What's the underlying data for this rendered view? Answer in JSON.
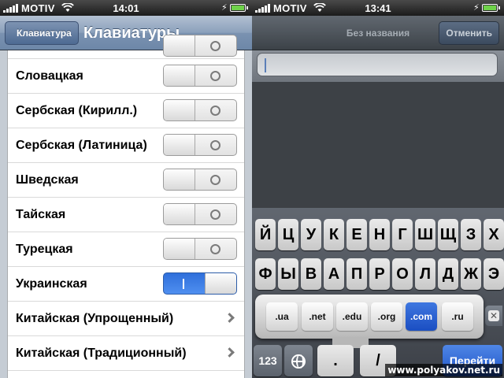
{
  "left": {
    "status": {
      "carrier": "MOTIV",
      "time": "14:01"
    },
    "nav": {
      "back_label": "Клавиатура",
      "title": "Клавиатуры"
    },
    "rows": [
      {
        "label": "Словацкая",
        "state": "off"
      },
      {
        "label": "Сербская (Кирилл.)",
        "state": "off"
      },
      {
        "label": "Сербская (Латиница)",
        "state": "off"
      },
      {
        "label": "Шведская",
        "state": "off"
      },
      {
        "label": "Тайская",
        "state": "off"
      },
      {
        "label": "Турецкая",
        "state": "off"
      },
      {
        "label": "Украинская",
        "state": "on"
      },
      {
        "label": "Китайская (Упрощенный)",
        "state": "chevron"
      },
      {
        "label": "Китайская (Традиционный)",
        "state": "chevron"
      }
    ]
  },
  "right": {
    "status": {
      "carrier": "MOTIV",
      "time": "13:41"
    },
    "nav": {
      "title": "Без названия",
      "cancel_label": "Отменить"
    },
    "keyboard": {
      "row1": [
        "Й",
        "Ц",
        "У",
        "К",
        "Е",
        "Н",
        "Г",
        "Ш",
        "Щ",
        "З",
        "Х"
      ],
      "row2": [
        "Ф",
        "Ы",
        "В",
        "А",
        "П",
        "Р",
        "О",
        "Л",
        "Д",
        "Ж",
        "Э"
      ],
      "domains": [
        ".ua",
        ".net",
        ".edu",
        ".org",
        ".com",
        ".ru"
      ],
      "active_domain": ".com",
      "num_key": "123",
      "dot_key": ".",
      "slash_key": "/",
      "go_key": "Перейти"
    }
  },
  "watermark": "www.polyakov.net.ru",
  "colors": {
    "toggle_on": "#2f6fdb",
    "nav_left": "#6d87a8",
    "go_key": "#1f55c7"
  }
}
